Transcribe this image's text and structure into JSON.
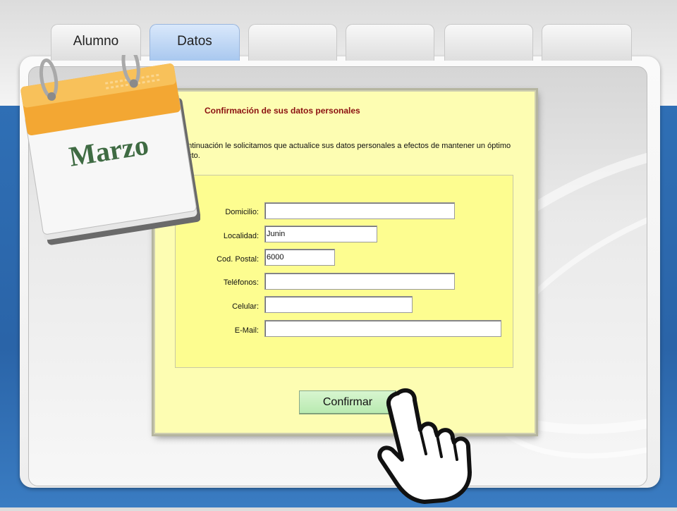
{
  "tabs": [
    {
      "label": "Alumno"
    },
    {
      "label": "Datos"
    },
    {
      "label": ""
    },
    {
      "label": ""
    },
    {
      "label": ""
    },
    {
      "label": ""
    }
  ],
  "calendar": {
    "month": "Marzo"
  },
  "dialog": {
    "title": "Confirmación de sus datos personales",
    "intro_line1": "ontinuación le solicitamos que actualice sus datos personales a efectos de mantener un óptimo",
    "intro_line2": "acto.",
    "fields": {
      "domicilio": {
        "label": "Domicilio:",
        "value": ""
      },
      "localidad": {
        "label": "Localidad:",
        "value": "Junin"
      },
      "cod_postal": {
        "label": "Cod. Postal:",
        "value": "6000"
      },
      "telefonos": {
        "label": "Teléfonos:",
        "value": ""
      },
      "celular": {
        "label": "Celular:",
        "value": ""
      },
      "email": {
        "label": "E-Mail:",
        "value": ""
      }
    },
    "confirm_label": "Confirmar"
  },
  "icons": {
    "calendar": "calendar-icon",
    "hand": "pointing-hand-icon"
  }
}
